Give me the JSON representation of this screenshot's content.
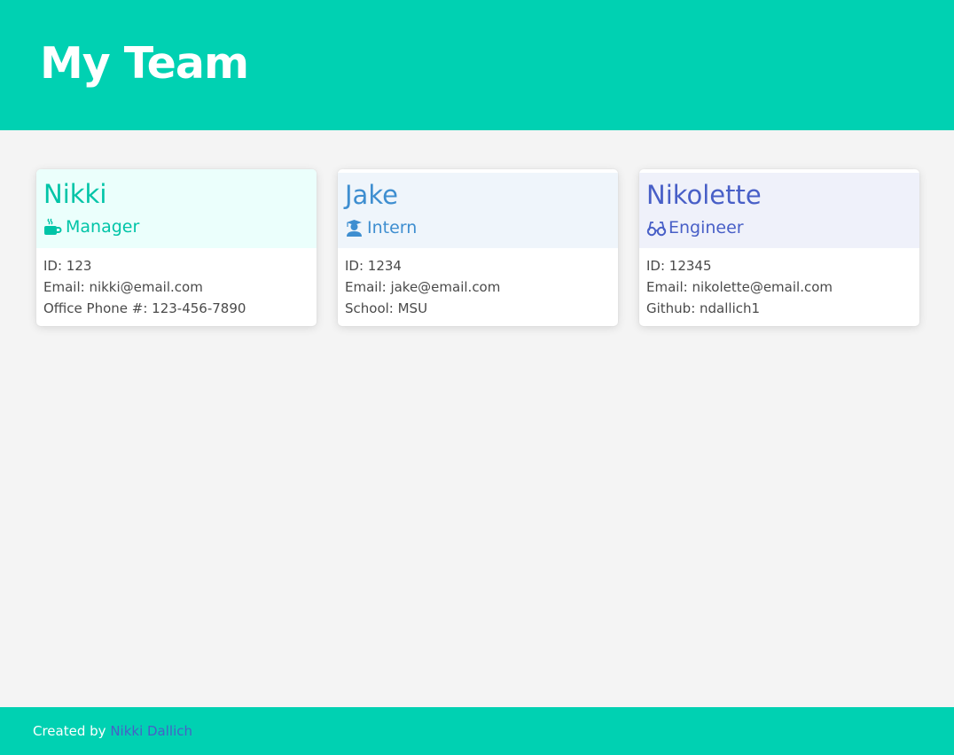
{
  "header": {
    "title": "My Team"
  },
  "team": [
    {
      "name": "Nikki",
      "role": "Manager",
      "icon": "coffee-mug-icon",
      "details": [
        "ID: 123",
        "Email: nikki@email.com",
        "Office Phone #: 123-456-7890"
      ],
      "color": "#00c4a7"
    },
    {
      "name": "Jake",
      "role": "Intern",
      "icon": "graduate-icon",
      "details": [
        "ID: 1234",
        "Email: jake@email.com",
        "School: MSU"
      ],
      "color": "#3e8ed0"
    },
    {
      "name": "Nikolette",
      "role": "Engineer",
      "icon": "glasses-icon",
      "details": [
        "ID: 12345",
        "Email: nikolette@email.com",
        "Github: ndallich1"
      ],
      "color": "#485fc7"
    }
  ],
  "footer": {
    "prefix": "Created by",
    "author_link": "Nikki Dallich"
  },
  "colors": {
    "brand": "#00d1b2",
    "background": "#f4f4f4",
    "link": "#485fc7"
  }
}
